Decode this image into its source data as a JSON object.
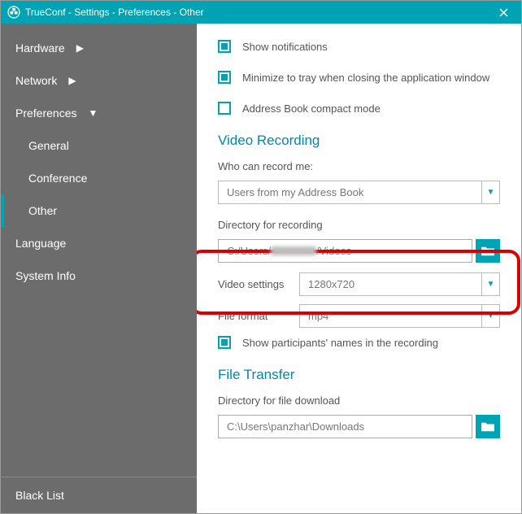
{
  "titlebar": {
    "title": "TrueConf - Settings - Preferences - Other"
  },
  "sidebar": {
    "items": [
      {
        "label": "Hardware",
        "expandable": true,
        "expanded": false
      },
      {
        "label": "Network",
        "expandable": true,
        "expanded": false
      },
      {
        "label": "Preferences",
        "expandable": true,
        "expanded": true
      },
      {
        "label": "Language",
        "expandable": false
      },
      {
        "label": "System Info",
        "expandable": false
      }
    ],
    "preferences_sub": [
      {
        "label": "General",
        "active": false
      },
      {
        "label": "Conference",
        "active": false
      },
      {
        "label": "Other",
        "active": true
      }
    ],
    "blacklist": "Black List"
  },
  "content": {
    "show_notifications": "Show notifications",
    "minimize_tray": "Minimize to tray when closing the application window",
    "ab_compact": "Address Book compact mode",
    "video_recording_title": "Video Recording",
    "who_can_record": "Who can record me:",
    "who_can_record_value": "Users from my Address Book",
    "dir_recording_label": "Directory for recording",
    "dir_recording_prefix": "C:/Users/",
    "dir_recording_suffix": "/Videos",
    "video_settings_label": "Video settings",
    "video_settings_value": "1280x720",
    "file_format_label": "File format",
    "file_format_value": "mp4",
    "show_participants": "Show participants' names in the recording",
    "file_transfer_title": "File Transfer",
    "dir_download_label": "Directory for file download",
    "dir_download_value": "C:\\Users\\panzhar\\Downloads"
  }
}
